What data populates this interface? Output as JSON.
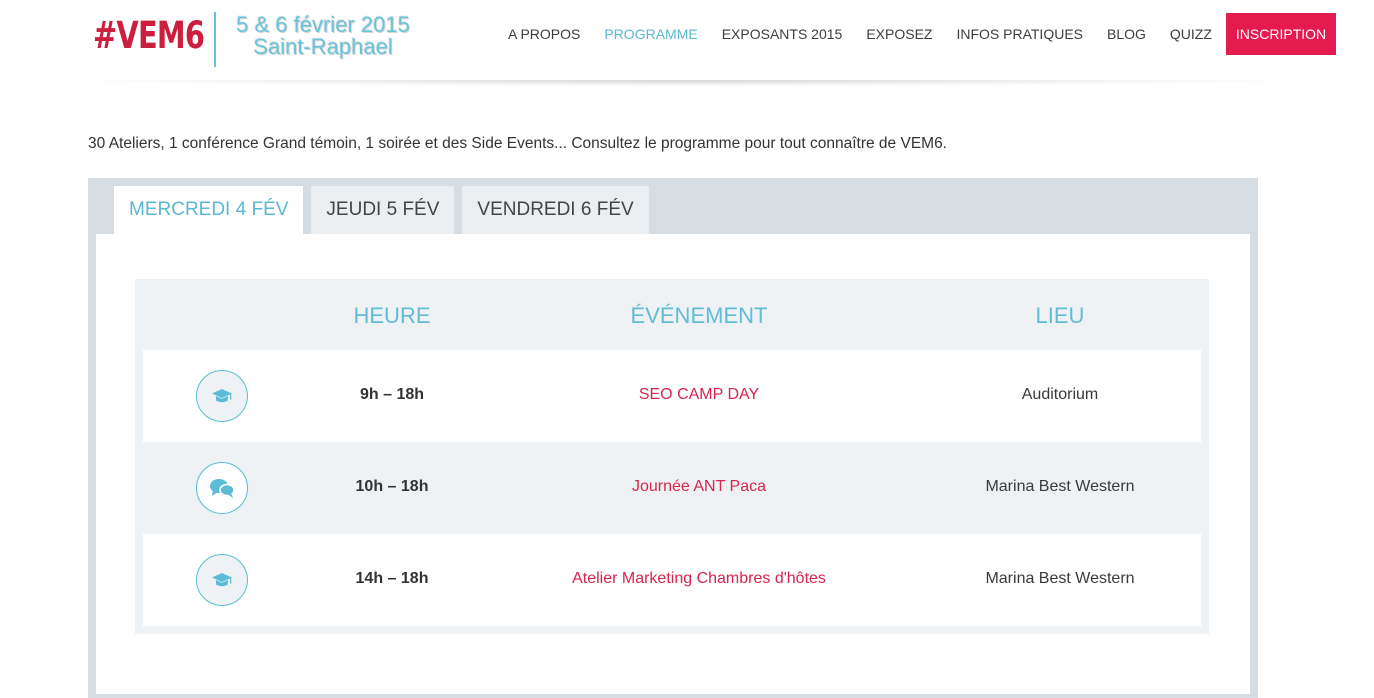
{
  "header": {
    "logo": "#VEM6",
    "date_line1": "5 & 6 février 2015",
    "date_line2": "Saint-Raphael",
    "nav": [
      "A PROPOS",
      "PROGRAMME",
      "EXPOSANTS 2015",
      "EXPOSEZ",
      "INFOS PRATIQUES",
      "BLOG",
      "QUIZZ"
    ],
    "nav_active": "PROGRAMME",
    "cta": "INSCRIPTION"
  },
  "intro": "30 Ateliers, 1 conférence Grand témoin, 1 soirée et des Side Events... Consultez le programme pour tout connaître de VEM6.",
  "tabs": [
    {
      "label": "MERCREDI 4 FÉV",
      "active": true
    },
    {
      "label": "JEUDI 5 FÉV",
      "active": false
    },
    {
      "label": "VENDREDI 6 FÉV",
      "active": false
    }
  ],
  "table": {
    "headers": {
      "time": "HEURE",
      "event": "ÉVÉNEMENT",
      "place": "LIEU"
    },
    "rows": [
      {
        "icon": "graduation-cap-icon",
        "time": "9h – 18h",
        "event": "SEO CAMP DAY",
        "place": "Auditorium"
      },
      {
        "icon": "chat-bubbles-icon",
        "time": "10h – 18h",
        "event": "Journée ANT Paca",
        "place": "Marina Best Western"
      },
      {
        "icon": "graduation-cap-icon",
        "time": "14h – 18h",
        "event": "Atelier Marketing Chambres d'hôtes",
        "place": "Marina Best Western"
      }
    ]
  },
  "colors": {
    "brand_red": "#cc1f3e",
    "accent_blue": "#5bb7d3",
    "cta_pink": "#e31b4f",
    "event_pink": "#d6254f"
  }
}
